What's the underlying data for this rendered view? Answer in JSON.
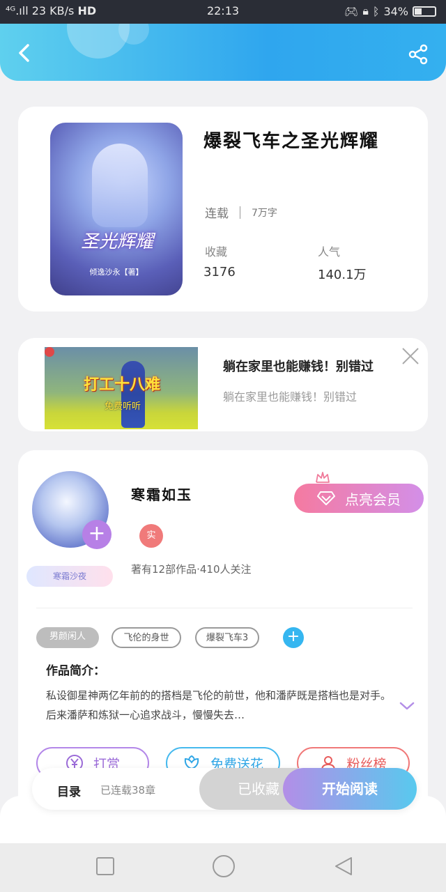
{
  "status_bar": {
    "network": "⁴ᴳ.ıll",
    "speed": "23 KB/s",
    "hd": "HD",
    "time": "22:13",
    "battery": "34%",
    "battery_level": 0.34
  },
  "book": {
    "title": "爆裂飞车之圣光辉耀",
    "status": "连载",
    "word_count": "7万字",
    "collect_label": "收藏",
    "collect_value": "3176",
    "popularity_label": "人气",
    "popularity_value": "140.1万",
    "cover_title": "圣光辉耀",
    "cover_author": "倾逸沙永【著】"
  },
  "ad": {
    "image_title": "打工十八难",
    "image_sub": "免费听听",
    "title": "躺在家里也能赚钱！别错过",
    "subtitle": "躺在家里也能赚钱！别错过"
  },
  "author": {
    "name": "寒霜如玉",
    "badge": "寒霜沙夜",
    "verified": "实",
    "info": "著有12部作品·410人关注",
    "vip_button": "点亮会员"
  },
  "tags": [
    "男颜闲人",
    "飞伦的身世",
    "爆裂飞车3"
  ],
  "intro": {
    "heading": "作品简介：",
    "text": "私设御星神两亿年前的的搭档是飞伦的前世，他和潘萨既是搭档也是对手。后来潘萨和炼狱一心追求战斗，慢慢失去…"
  },
  "actions": {
    "reward": "打赏",
    "flowers": "免费送花",
    "fans": "粉丝榜"
  },
  "bottom": {
    "catalog": "目录",
    "chapters": "已连载38章",
    "collected": "已收藏",
    "start_reading": "开始阅读"
  },
  "colors": {
    "header_blue": "#2fa6ee",
    "vip_pink": "#f57aa0",
    "accent_purple": "#b38ee7"
  }
}
